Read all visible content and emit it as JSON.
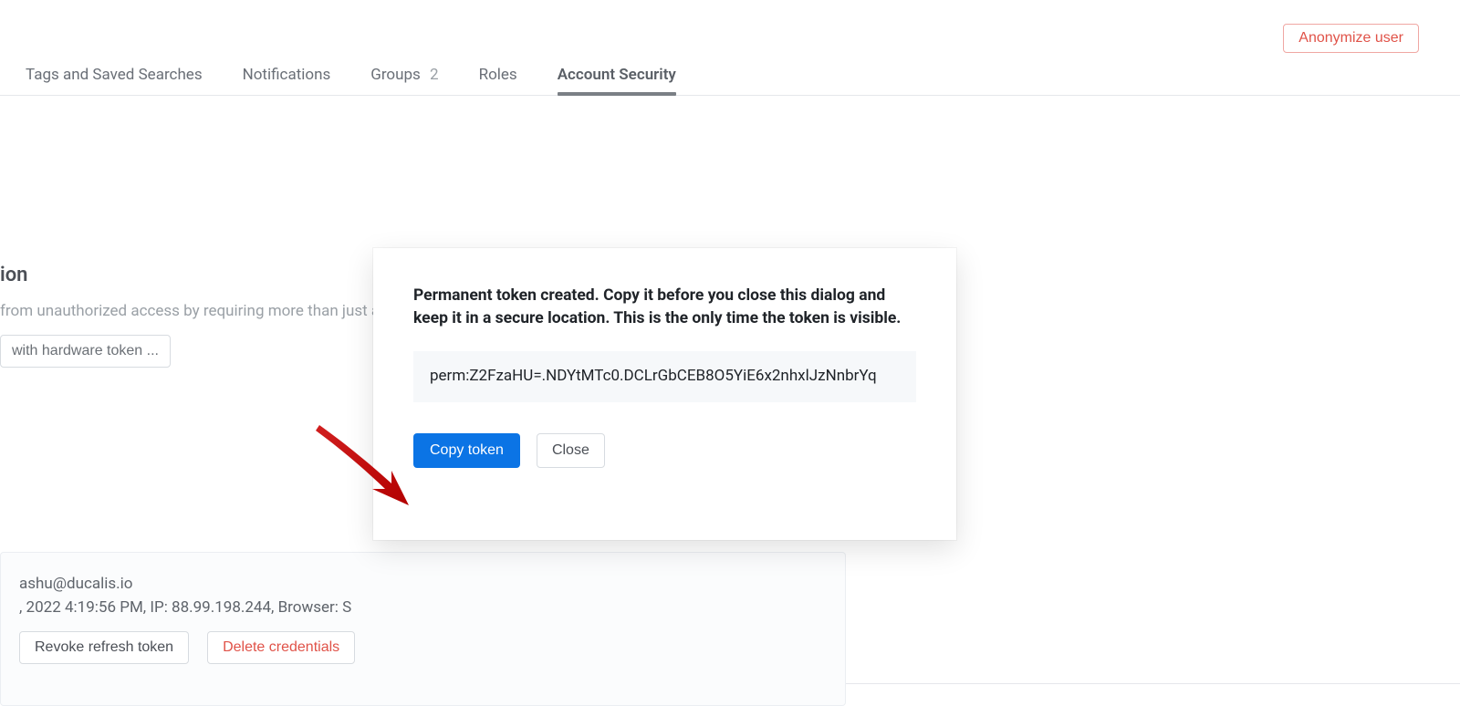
{
  "header": {
    "anonymize_label": "Anonymize user"
  },
  "tabs": {
    "items": [
      {
        "label": "Tags and Saved Searches"
      },
      {
        "label": "Notifications"
      },
      {
        "label": "Groups",
        "count": "2"
      },
      {
        "label": "Roles"
      },
      {
        "label": "Account Security",
        "active": true
      }
    ]
  },
  "section": {
    "title_fragment": "ion",
    "desc_fragment": "from unauthorized access by requiring more than just a password to sign in",
    "hw_button_fragment": "with hardware token ..."
  },
  "credentials": {
    "line1_fragment": "ashu@ducalis.io",
    "line2_fragment": ", 2022 4:19:56 PM, IP: 88.99.198.244, Browser: S",
    "revoke_label": "Revoke refresh token",
    "delete_label": "Delete credentials"
  },
  "dialog": {
    "headline": "Permanent token created. Copy it before you close this dialog and keep it in a secure location. This is the only time the token is visible.",
    "token": "perm:Z2FzaHU=.NDYtMTc0.DCLrGbCEB8O5YiE6x2nhxlJzNnbrYq",
    "copy_label": "Copy token",
    "close_label": "Close"
  },
  "colors": {
    "primary": "#0b74e5",
    "danger": "#e05248"
  }
}
